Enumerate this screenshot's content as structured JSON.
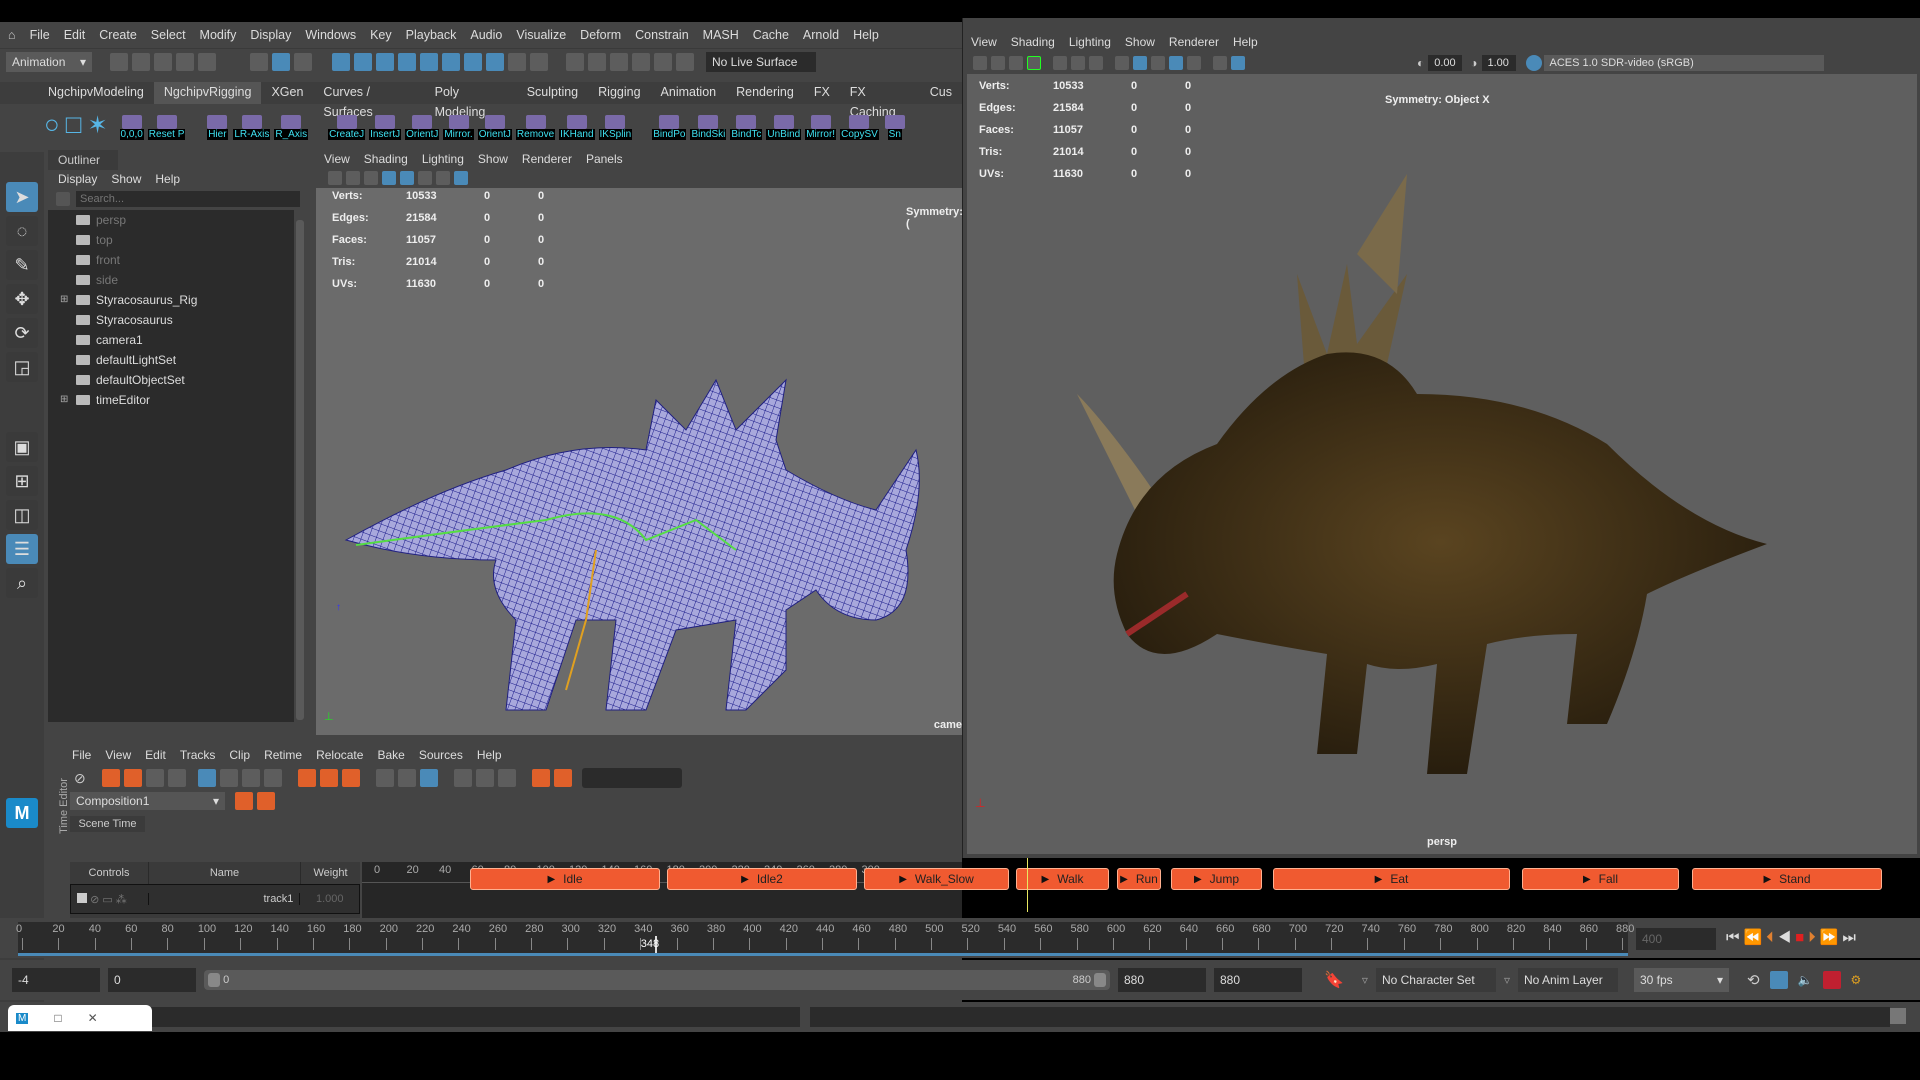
{
  "menu": [
    "File",
    "Edit",
    "Create",
    "Select",
    "Modify",
    "Display",
    "Windows",
    "Key",
    "Playback",
    "Audio",
    "Visualize",
    "Deform",
    "Constrain",
    "MASH",
    "Cache",
    "Arnold",
    "Help"
  ],
  "toolbar": {
    "mode": "Animation",
    "live_surface": "No Live Surface"
  },
  "shelf_tabs": [
    "NgchipvModeling",
    "NgchipvRigging",
    "XGen",
    "Curves / Surfaces",
    "Poly Modeling",
    "Sculpting",
    "Rigging",
    "Animation",
    "Rendering",
    "FX",
    "FX Caching",
    "Cus"
  ],
  "shelf_buttons": [
    "0,0,0",
    "Reset P",
    "Hier",
    "LR-Axis",
    "R_Axis",
    "CreateJ",
    "InsertJ",
    "OrientJ",
    "Mirror.",
    "OrientJ",
    "Remove",
    "IKHand",
    "IKSplin",
    "BindPo",
    "BindSki",
    "BindTc",
    "UnBind",
    "Mirror!",
    "CopySV",
    "Sn"
  ],
  "outliner": {
    "title": "Outliner",
    "menu": [
      "Display",
      "Show",
      "Help"
    ],
    "search_placeholder": "Search...",
    "items": [
      {
        "label": "persp",
        "dim": true
      },
      {
        "label": "top",
        "dim": true
      },
      {
        "label": "front",
        "dim": true
      },
      {
        "label": "side",
        "dim": true
      },
      {
        "label": "Styracosaurus_Rig",
        "expand": true
      },
      {
        "label": "Styracosaurus"
      },
      {
        "label": "camera1"
      },
      {
        "label": "defaultLightSet"
      },
      {
        "label": "defaultObjectSet"
      },
      {
        "label": "timeEditor",
        "expand": true
      }
    ]
  },
  "viewport_left": {
    "menu": [
      "View",
      "Shading",
      "Lighting",
      "Show",
      "Renderer",
      "Panels"
    ],
    "symmetry": "Symmetry: (",
    "camera": "came"
  },
  "viewport_right": {
    "menu": [
      "View",
      "Shading",
      "Lighting",
      "Show",
      "Renderer",
      "Help"
    ],
    "exposure": "0.00",
    "gamma": "1.00",
    "color_space": "ACES 1.0 SDR-video (sRGB)",
    "symmetry": "Symmetry: Object X",
    "camera": "persp"
  },
  "stats": [
    [
      "Verts:",
      "10533",
      "0",
      "0"
    ],
    [
      "Edges:",
      "21584",
      "0",
      "0"
    ],
    [
      "Faces:",
      "11057",
      "0",
      "0"
    ],
    [
      "Tris:",
      "21014",
      "0",
      "0"
    ],
    [
      "UVs:",
      "11630",
      "0",
      "0"
    ]
  ],
  "time_editor": {
    "side_label": "Time Editor",
    "menu": [
      "File",
      "View",
      "Edit",
      "Tracks",
      "Clip",
      "Retime",
      "Relocate",
      "Bake",
      "Sources",
      "Help"
    ],
    "composition": "Composition1",
    "scene_time": "Scene Time",
    "columns": [
      "Controls",
      "Name",
      "Weight"
    ],
    "track": {
      "name": "track1",
      "weight": "1.000"
    },
    "ruler": [
      "0",
      "20",
      "40",
      "60",
      "80",
      "100",
      "120",
      "140",
      "160",
      "180",
      "200",
      "220",
      "240",
      "260",
      "280",
      "300"
    ],
    "clips": [
      {
        "label": "Idle",
        "start": 470,
        "end": 660
      },
      {
        "label": "Idle2",
        "start": 667,
        "end": 857
      },
      {
        "label": "Walk_Slow",
        "start": 864,
        "end": 1009
      },
      {
        "label": "Walk",
        "start": 1016,
        "end": 1109
      },
      {
        "label": "Run",
        "start": 1117,
        "end": 1161
      },
      {
        "label": "Jump",
        "start": 1171,
        "end": 1262
      },
      {
        "label": "Eat",
        "start": 1273,
        "end": 1510
      },
      {
        "label": "Fall",
        "start": 1522,
        "end": 1679
      },
      {
        "label": "Stand",
        "start": 1692,
        "end": 1882
      }
    ]
  },
  "time_slider": {
    "min": 0,
    "max": 880,
    "step": 20,
    "current": "348",
    "end_field": "400"
  },
  "range": {
    "start": "-4",
    "anim_start": "0",
    "slider_start": "0",
    "slider_end": "880",
    "anim_end": "880",
    "end": "880",
    "character_set": "No Character Set",
    "anim_layer": "No Anim Layer",
    "fps": "30 fps"
  },
  "colors": {
    "accent": "#4a8ab8",
    "clip": "#f05a30"
  }
}
